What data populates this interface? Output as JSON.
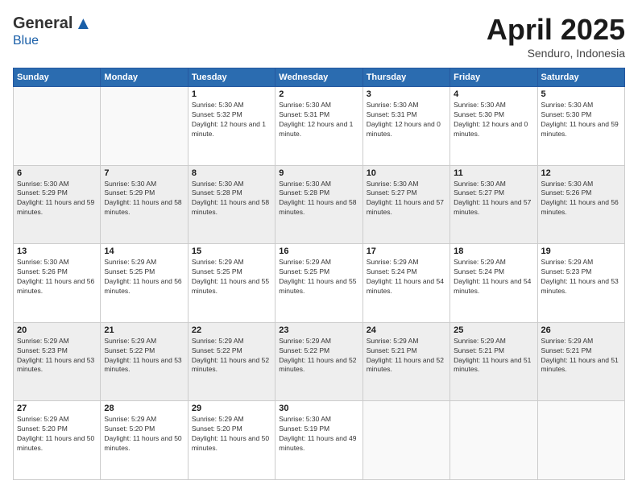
{
  "logo": {
    "general": "General",
    "blue": "Blue",
    "tagline": ""
  },
  "header": {
    "month": "April 2025",
    "location": "Senduro, Indonesia"
  },
  "weekdays": [
    "Sunday",
    "Monday",
    "Tuesday",
    "Wednesday",
    "Thursday",
    "Friday",
    "Saturday"
  ],
  "weeks": [
    [
      null,
      null,
      {
        "day": 1,
        "sunrise": "5:30 AM",
        "sunset": "5:32 PM",
        "daylight": "12 hours and 1 minute."
      },
      {
        "day": 2,
        "sunrise": "5:30 AM",
        "sunset": "5:31 PM",
        "daylight": "12 hours and 1 minute."
      },
      {
        "day": 3,
        "sunrise": "5:30 AM",
        "sunset": "5:31 PM",
        "daylight": "12 hours and 0 minutes."
      },
      {
        "day": 4,
        "sunrise": "5:30 AM",
        "sunset": "5:30 PM",
        "daylight": "12 hours and 0 minutes."
      },
      {
        "day": 5,
        "sunrise": "5:30 AM",
        "sunset": "5:30 PM",
        "daylight": "11 hours and 59 minutes."
      }
    ],
    [
      {
        "day": 6,
        "sunrise": "5:30 AM",
        "sunset": "5:29 PM",
        "daylight": "11 hours and 59 minutes."
      },
      {
        "day": 7,
        "sunrise": "5:30 AM",
        "sunset": "5:29 PM",
        "daylight": "11 hours and 58 minutes."
      },
      {
        "day": 8,
        "sunrise": "5:30 AM",
        "sunset": "5:28 PM",
        "daylight": "11 hours and 58 minutes."
      },
      {
        "day": 9,
        "sunrise": "5:30 AM",
        "sunset": "5:28 PM",
        "daylight": "11 hours and 58 minutes."
      },
      {
        "day": 10,
        "sunrise": "5:30 AM",
        "sunset": "5:27 PM",
        "daylight": "11 hours and 57 minutes."
      },
      {
        "day": 11,
        "sunrise": "5:30 AM",
        "sunset": "5:27 PM",
        "daylight": "11 hours and 57 minutes."
      },
      {
        "day": 12,
        "sunrise": "5:30 AM",
        "sunset": "5:26 PM",
        "daylight": "11 hours and 56 minutes."
      }
    ],
    [
      {
        "day": 13,
        "sunrise": "5:30 AM",
        "sunset": "5:26 PM",
        "daylight": "11 hours and 56 minutes."
      },
      {
        "day": 14,
        "sunrise": "5:29 AM",
        "sunset": "5:25 PM",
        "daylight": "11 hours and 56 minutes."
      },
      {
        "day": 15,
        "sunrise": "5:29 AM",
        "sunset": "5:25 PM",
        "daylight": "11 hours and 55 minutes."
      },
      {
        "day": 16,
        "sunrise": "5:29 AM",
        "sunset": "5:25 PM",
        "daylight": "11 hours and 55 minutes."
      },
      {
        "day": 17,
        "sunrise": "5:29 AM",
        "sunset": "5:24 PM",
        "daylight": "11 hours and 54 minutes."
      },
      {
        "day": 18,
        "sunrise": "5:29 AM",
        "sunset": "5:24 PM",
        "daylight": "11 hours and 54 minutes."
      },
      {
        "day": 19,
        "sunrise": "5:29 AM",
        "sunset": "5:23 PM",
        "daylight": "11 hours and 53 minutes."
      }
    ],
    [
      {
        "day": 20,
        "sunrise": "5:29 AM",
        "sunset": "5:23 PM",
        "daylight": "11 hours and 53 minutes."
      },
      {
        "day": 21,
        "sunrise": "5:29 AM",
        "sunset": "5:22 PM",
        "daylight": "11 hours and 53 minutes."
      },
      {
        "day": 22,
        "sunrise": "5:29 AM",
        "sunset": "5:22 PM",
        "daylight": "11 hours and 52 minutes."
      },
      {
        "day": 23,
        "sunrise": "5:29 AM",
        "sunset": "5:22 PM",
        "daylight": "11 hours and 52 minutes."
      },
      {
        "day": 24,
        "sunrise": "5:29 AM",
        "sunset": "5:21 PM",
        "daylight": "11 hours and 52 minutes."
      },
      {
        "day": 25,
        "sunrise": "5:29 AM",
        "sunset": "5:21 PM",
        "daylight": "11 hours and 51 minutes."
      },
      {
        "day": 26,
        "sunrise": "5:29 AM",
        "sunset": "5:21 PM",
        "daylight": "11 hours and 51 minutes."
      }
    ],
    [
      {
        "day": 27,
        "sunrise": "5:29 AM",
        "sunset": "5:20 PM",
        "daylight": "11 hours and 50 minutes."
      },
      {
        "day": 28,
        "sunrise": "5:29 AM",
        "sunset": "5:20 PM",
        "daylight": "11 hours and 50 minutes."
      },
      {
        "day": 29,
        "sunrise": "5:29 AM",
        "sunset": "5:20 PM",
        "daylight": "11 hours and 50 minutes."
      },
      {
        "day": 30,
        "sunrise": "5:30 AM",
        "sunset": "5:19 PM",
        "daylight": "11 hours and 49 minutes."
      },
      null,
      null,
      null
    ]
  ]
}
